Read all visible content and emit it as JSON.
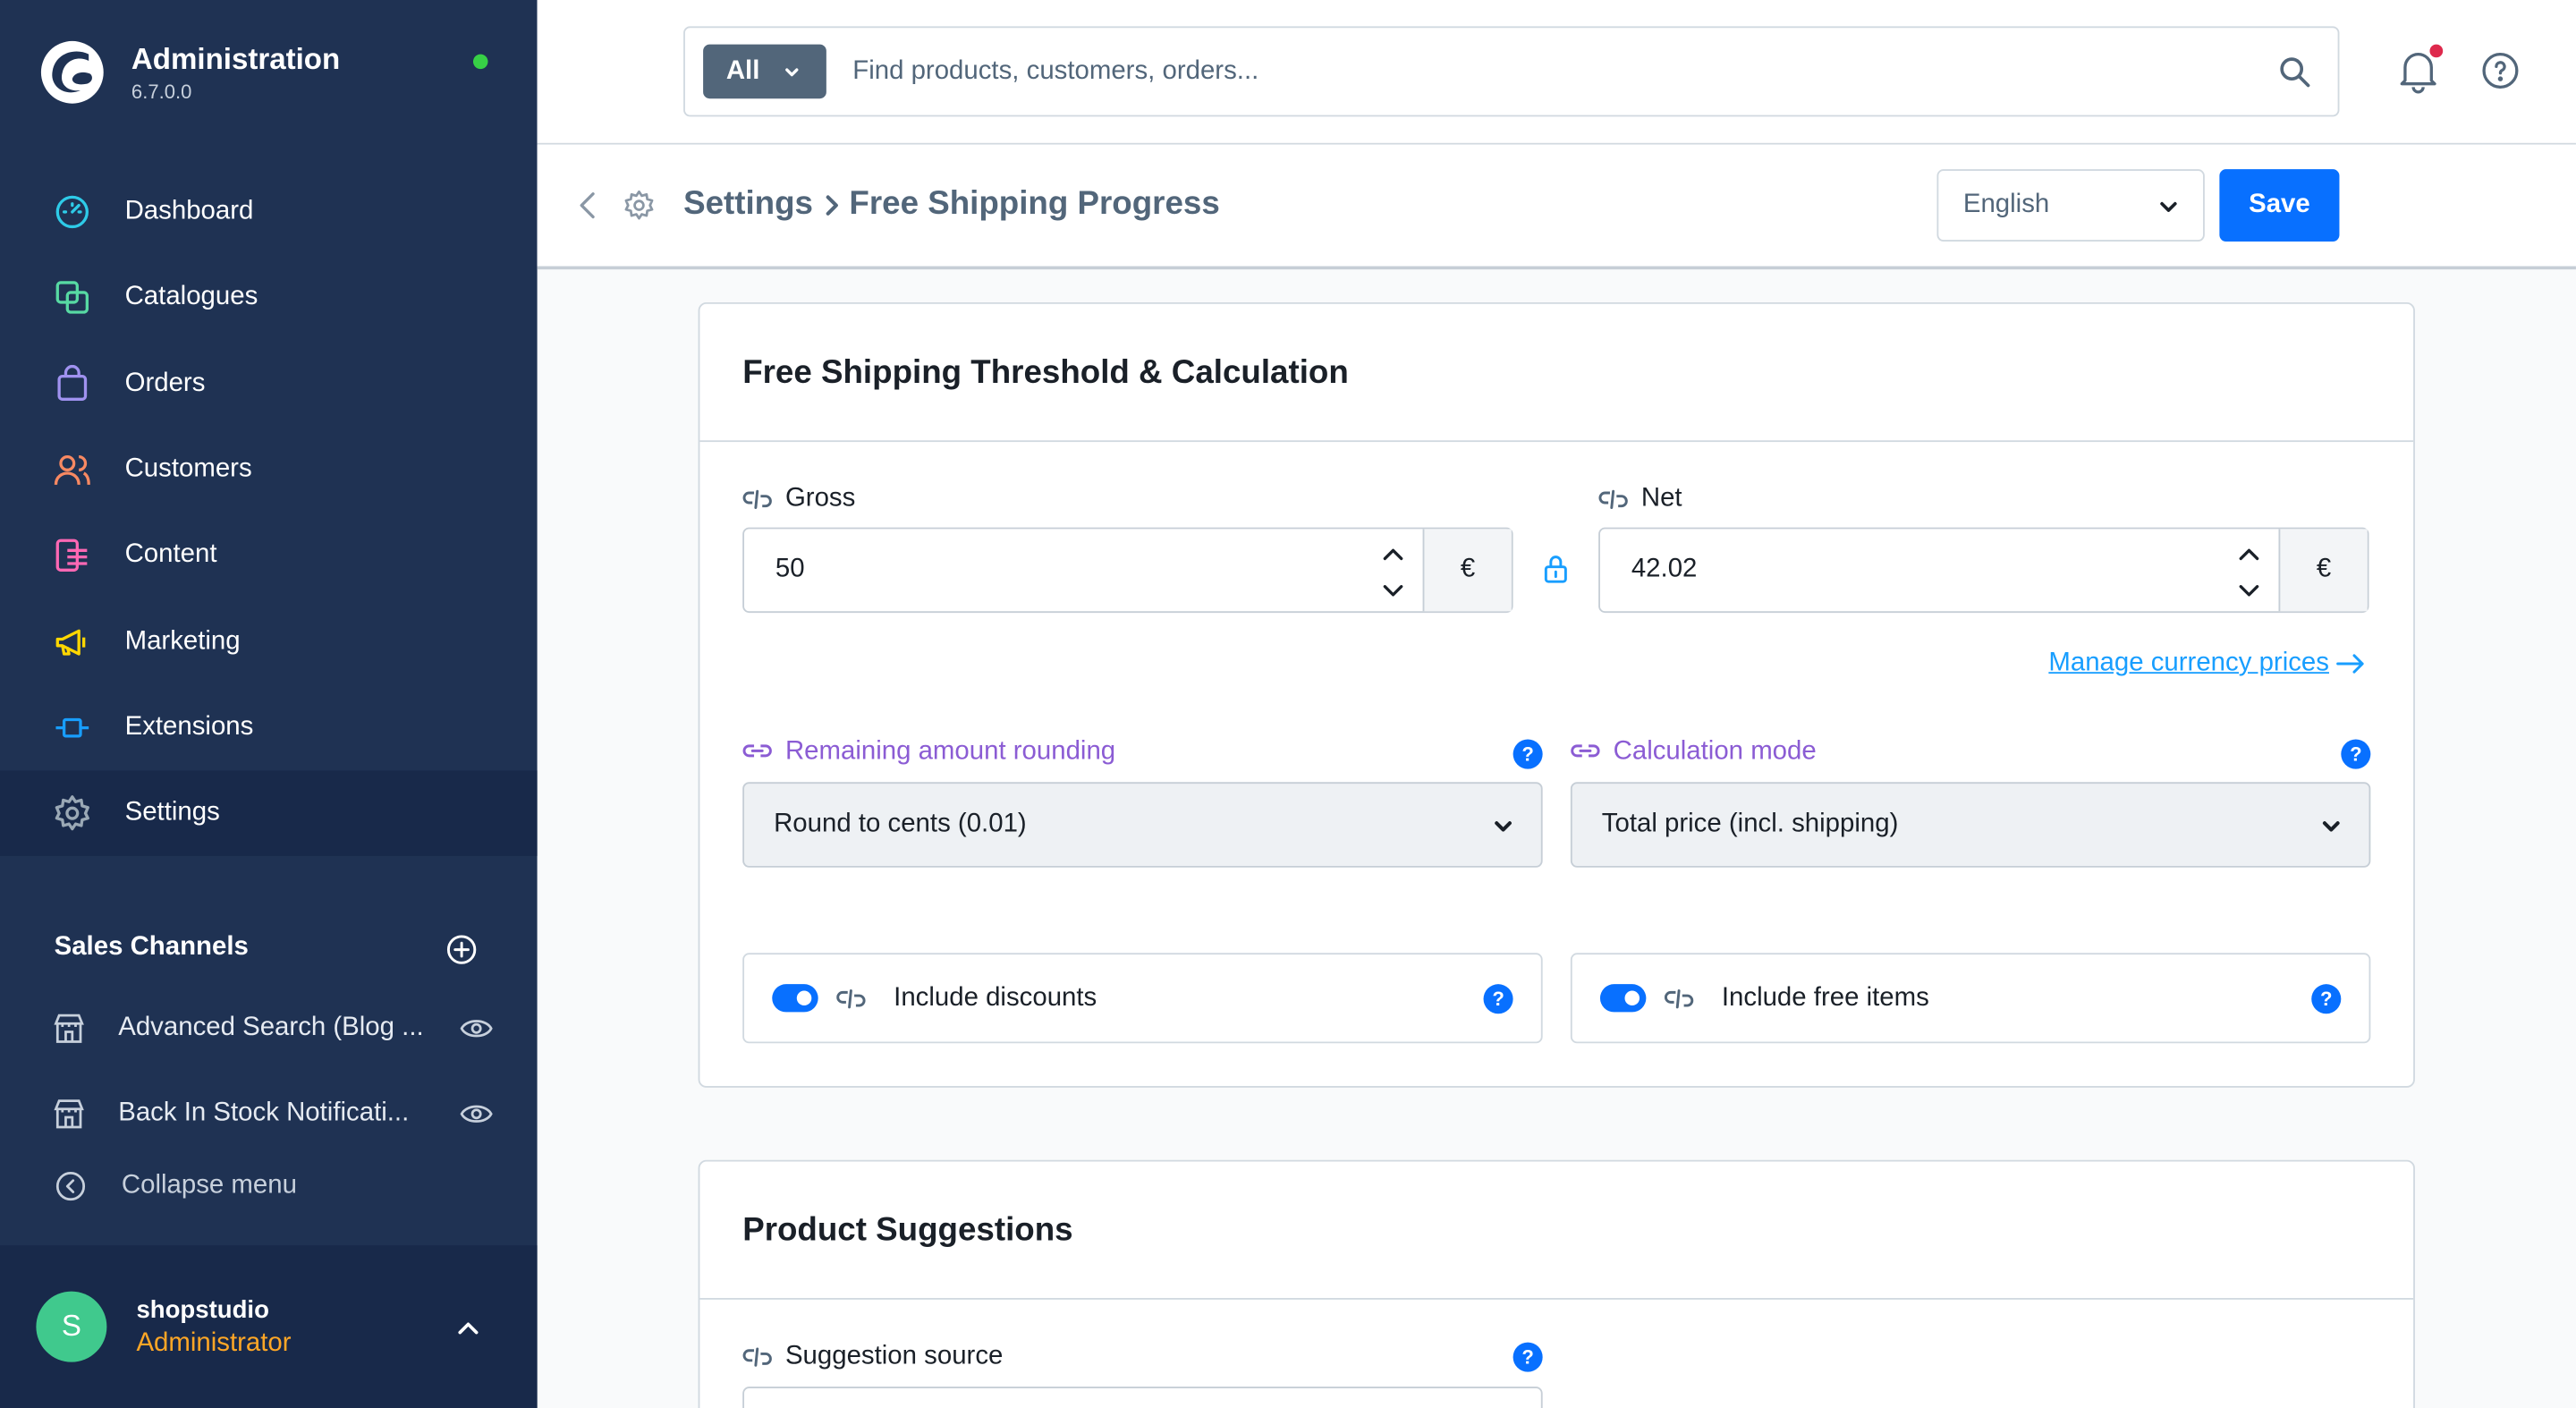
{
  "app": {
    "title": "Administration",
    "version": "6.7.0.0"
  },
  "nav": {
    "items": [
      {
        "label": "Dashboard",
        "icon": "dashboard-icon",
        "color": "#2ecbe8"
      },
      {
        "label": "Catalogues",
        "icon": "catalogues-icon",
        "color": "#57d9a3"
      },
      {
        "label": "Orders",
        "icon": "orders-icon",
        "color": "#a092f0"
      },
      {
        "label": "Customers",
        "icon": "customers-icon",
        "color": "#f88962"
      },
      {
        "label": "Content",
        "icon": "content-icon",
        "color": "#ff68b4"
      },
      {
        "label": "Marketing",
        "icon": "marketing-icon",
        "color": "#ffd700"
      },
      {
        "label": "Extensions",
        "icon": "extensions-icon",
        "color": "#189eff"
      },
      {
        "label": "Settings",
        "icon": "settings-icon",
        "color": "#9aa8b5"
      }
    ],
    "active": "Settings"
  },
  "sales_channels": {
    "header": "Sales Channels",
    "items": [
      {
        "label": "Advanced Search (Blog ..."
      },
      {
        "label": "Back In Stock Notificati..."
      }
    ],
    "collapse_label": "Collapse menu"
  },
  "user": {
    "initial": "S",
    "name": "shopstudio",
    "role": "Administrator"
  },
  "search": {
    "scope": "All",
    "placeholder": "Find products, customers, orders..."
  },
  "smartbar": {
    "crumb_parent": "Settings",
    "crumb_current": "Free Shipping Progress",
    "language": "English",
    "save_label": "Save"
  },
  "threshold_card": {
    "title": "Free Shipping Threshold & Calculation",
    "gross_label": "Gross",
    "gross_value": "50",
    "net_label": "Net",
    "net_value": "42.02",
    "currency_symbol": "€",
    "manage_link": "Manage currency prices",
    "rounding_label": "Remaining amount rounding",
    "rounding_value": "Round to cents (0.01)",
    "calc_mode_label": "Calculation mode",
    "calc_mode_value": "Total price (incl. shipping)",
    "include_discounts_label": "Include discounts",
    "include_free_items_label": "Include free items",
    "help_glyph": "?"
  },
  "suggestions_card": {
    "title": "Product Suggestions",
    "source_label": "Suggestion source"
  },
  "colors": {
    "sidebar": "#1f3253",
    "sidebar_active": "#18294a",
    "primary": "#0870ff",
    "inherited": "#8b5cd4",
    "link": "#189eff",
    "role": "#ffa726",
    "online": "#37d046",
    "notification": "#de294c"
  }
}
